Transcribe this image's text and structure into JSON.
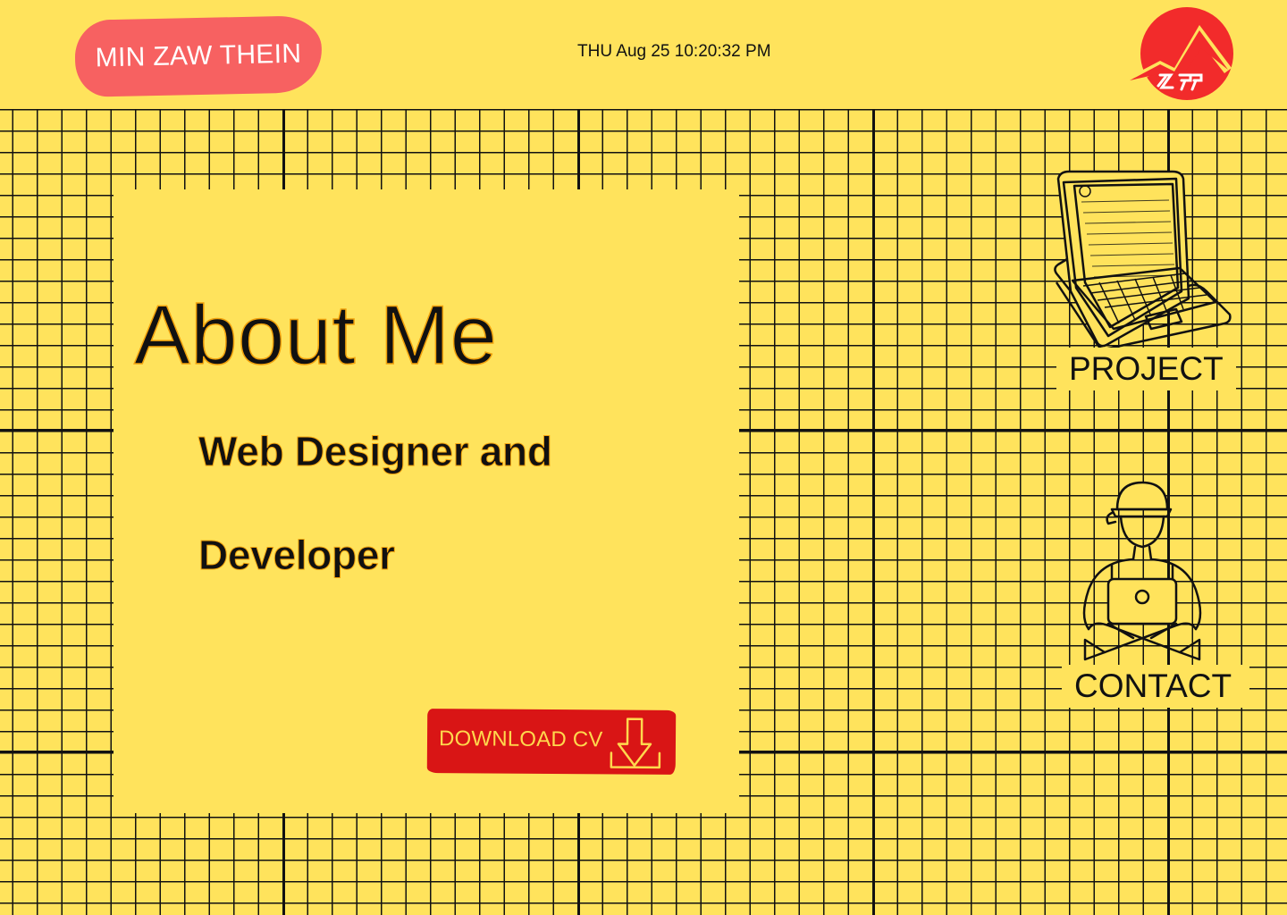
{
  "header": {
    "name": "MIN ZAW THEIN",
    "datetime": "THU Aug 25 10:20:32 PM",
    "logo_icon": "mountain-logo-icon"
  },
  "about": {
    "title": "About Me",
    "role_line1": "Web Designer and",
    "role_line2": "Developer",
    "download_label": "DOWNLOAD CV",
    "download_icon": "download-arrow-icon"
  },
  "nav": {
    "project_label": "PROJECT",
    "project_icon": "laptop-icon",
    "contact_label": "CONTACT",
    "contact_icon": "person-with-laptop-icon"
  },
  "colors": {
    "background": "#FFE35C",
    "grid_lines": "#111111",
    "name_badge": "#F76161",
    "button": "#D91515",
    "button_text": "#FFD84D",
    "text_outline": "#F2A20C",
    "logo": "#F22B2B"
  }
}
